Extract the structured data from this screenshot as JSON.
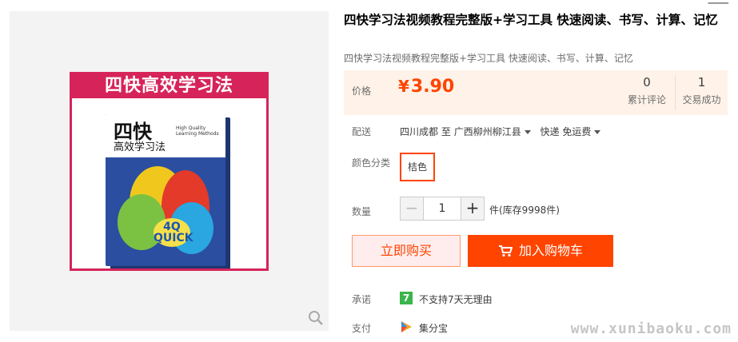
{
  "product": {
    "title": "四快学习法视频教程完整版+学习工具 快速阅读、书写、计算、记忆",
    "subtitle": "四快学习法视频教程完整版+学习工具 快速阅读、书写、计算、记忆",
    "image": {
      "banner": "四快高效学习法",
      "book_title": "四快",
      "book_subtitle": "高效学习法",
      "book_en": "High Quality Learning Methods",
      "book_badge": "4Q QUICK"
    }
  },
  "price": {
    "label": "价格",
    "currency": "¥",
    "value": "3.90",
    "reviews_count": "0",
    "reviews_label": "累计评论",
    "sold_count": "1",
    "sold_label": "交易成功"
  },
  "shipping": {
    "label": "配送",
    "origin": "四川成都",
    "to": "至",
    "destination": "广西柳州柳江县",
    "method": "快递 免运费"
  },
  "sku": {
    "label": "颜色分类",
    "options": [
      "桔色"
    ]
  },
  "quantity": {
    "label": "数量",
    "minus": "−",
    "value": "1",
    "plus": "+",
    "stock_text": "件(库存9998件)"
  },
  "actions": {
    "buy_now": "立即购买",
    "add_to_cart": "加入购物车"
  },
  "promise": {
    "label": "承诺",
    "icon_text": "7",
    "text": "不支持7天无理由"
  },
  "payment": {
    "label": "支付",
    "text": "集分宝"
  },
  "watermark": "www.xunibaoku.com",
  "colors": {
    "accent": "#ff4400",
    "price_bg": "#fff2e8",
    "promise_green": "#3ab54a"
  }
}
